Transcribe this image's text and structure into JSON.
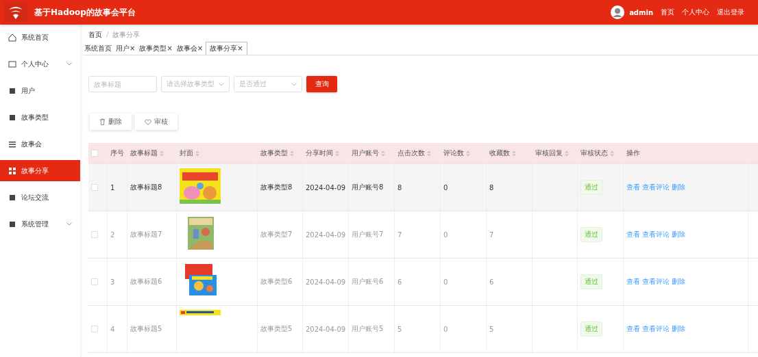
{
  "header": {
    "title": "基于Hadoop的故事会平台",
    "user": "admin",
    "links": [
      "首页",
      "个人中心",
      "退出登录"
    ]
  },
  "sidebar": {
    "items": [
      {
        "label": "系统首页",
        "selected": false,
        "expandable": false
      },
      {
        "label": "个人中心",
        "selected": false,
        "expandable": true
      },
      {
        "label": "用户",
        "selected": false,
        "expandable": false
      },
      {
        "label": "故事类型",
        "selected": false,
        "expandable": false
      },
      {
        "label": "故事会",
        "selected": false,
        "expandable": false
      },
      {
        "label": "故事分享",
        "selected": true,
        "expandable": false
      },
      {
        "label": "论坛交流",
        "selected": false,
        "expandable": false
      },
      {
        "label": "系统管理",
        "selected": false,
        "expandable": true
      }
    ]
  },
  "breadcrumb": [
    "首页",
    "故事分享"
  ],
  "breadcrumb_separator": "/",
  "tabs": [
    {
      "label": "系统首页",
      "selected": false,
      "closable": false
    },
    {
      "label": "用户",
      "selected": false,
      "closable": true
    },
    {
      "label": "故事类型",
      "selected": false,
      "closable": true
    },
    {
      "label": "故事会",
      "selected": false,
      "closable": true
    },
    {
      "label": "故事分享",
      "selected": true,
      "closable": true
    }
  ],
  "close_glyph": "×",
  "filters": {
    "title": {
      "placeholder": "故事标题"
    },
    "type": {
      "placeholder": "请选择故事类型"
    },
    "passed": {
      "placeholder": "是否通过"
    },
    "search_button": "查询"
  },
  "actions": [
    "删除",
    "审核"
  ],
  "table": {
    "all_checked": false,
    "columns": [
      {
        "label": "序号",
        "sortable": false
      },
      {
        "label": "故事标题",
        "sortable": true
      },
      {
        "label": "封面",
        "sortable": true
      },
      {
        "label": "故事类型",
        "sortable": true
      },
      {
        "label": "分享时间",
        "sortable": true
      },
      {
        "label": "用户账号",
        "sortable": true
      },
      {
        "label": "点击次数",
        "sortable": true
      },
      {
        "label": "评论数",
        "sortable": true
      },
      {
        "label": "收藏数",
        "sortable": true
      },
      {
        "label": "审核回复",
        "sortable": true
      },
      {
        "label": "审核状态",
        "sortable": true
      },
      {
        "label": "操作",
        "sortable": false
      }
    ],
    "rows": [
      {
        "highlighted": true,
        "checked": false,
        "index": "1",
        "title": "故事标题8",
        "cover": {
          "kind": "picture"
        },
        "type": "故事类型8",
        "date": "2024-04-09",
        "account": "用户账号8",
        "clicks": "8",
        "comments": "0",
        "favorites": "8",
        "status": "通过",
        "ops": [
          "查看",
          "查看评论",
          "删除"
        ]
      },
      {
        "highlighted": false,
        "checked": false,
        "index": "2",
        "title": "故事标题7",
        "cover": {
          "kind": "picture"
        },
        "type": "故事类型7",
        "date": "2024-04-09",
        "account": "用户账号7",
        "clicks": "7",
        "comments": "0",
        "favorites": "7",
        "status": "通过",
        "ops": [
          "查看",
          "查看评论",
          "删除"
        ]
      },
      {
        "highlighted": false,
        "checked": false,
        "index": "3",
        "title": "故事标题6",
        "cover": {
          "kind": "picture"
        },
        "type": "故事类型6",
        "date": "2024-04-09",
        "account": "用户账号6",
        "clicks": "6",
        "comments": "0",
        "favorites": "6",
        "status": "通过",
        "ops": [
          "查看",
          "查看评论",
          "删除"
        ]
      },
      {
        "highlighted": false,
        "checked": false,
        "index": "4",
        "title": "故事标题5",
        "cover": {
          "kind": "picture"
        },
        "type": "故事类型5",
        "date": "2024-04-09",
        "account": "用户账号5",
        "clicks": "5",
        "comments": "0",
        "favorites": "5",
        "status": "通过",
        "ops": [
          "查看",
          "查看评论",
          "删除"
        ]
      }
    ]
  }
}
